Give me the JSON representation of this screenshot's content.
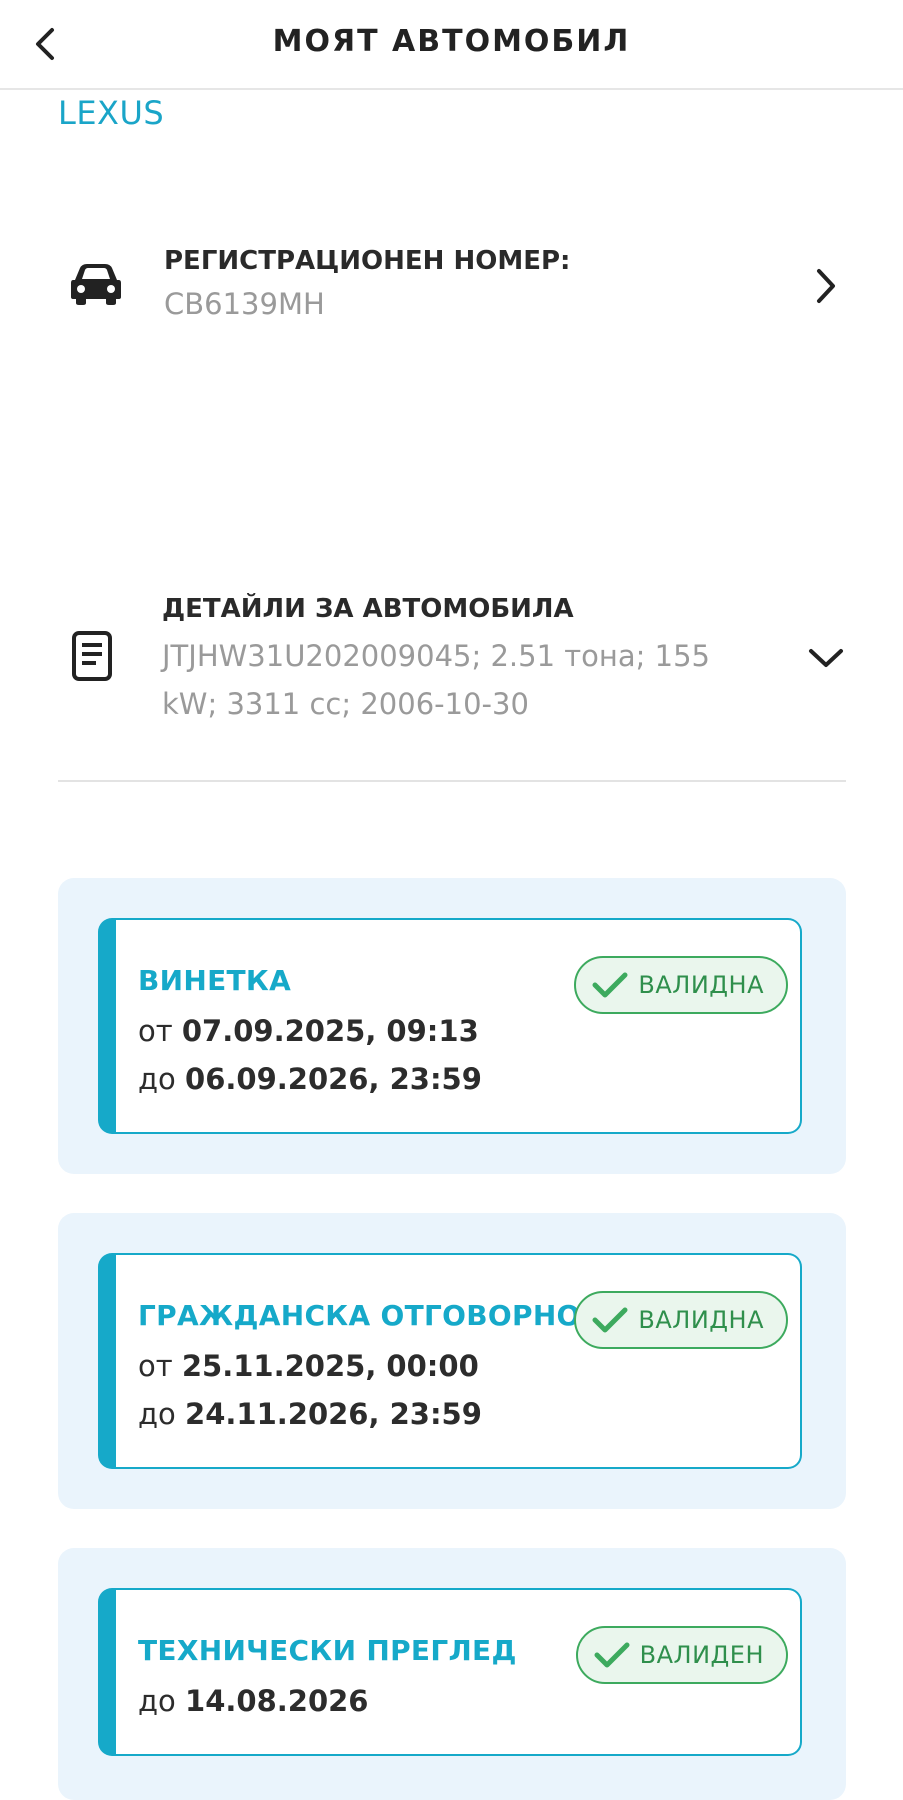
{
  "header": {
    "title": "МОЯТ АВТОМОБИЛ",
    "back_icon": "chevron-left-icon"
  },
  "brand": "LEXUS",
  "registration": {
    "label": "РЕГИСТРАЦИОНЕН НОМЕР:",
    "value": "CB6139MH",
    "icon": "car-icon",
    "action_icon": "chevron-right-icon"
  },
  "details": {
    "label": "ДЕТАЙЛИ ЗА АВТОМОБИЛА",
    "value_line1": "JTJHW31U202009045; 2.51 тона; 155",
    "value_line2": "kW; 3311 cc; 2006-10-30",
    "icon": "document-icon",
    "action_icon": "chevron-down-icon"
  },
  "cards": [
    {
      "title": "ВИНЕТКА",
      "from_prefix": "от",
      "from": "07.09.2025, 09:13",
      "to_prefix": "до",
      "to": "06.09.2026, 23:59",
      "status": "ВАЛИДНА"
    },
    {
      "title": "ГРАЖДАНСКА ОТГОВОРНОСТ",
      "from_prefix": "от",
      "from": "25.11.2025, 00:00",
      "to_prefix": "до",
      "to": "24.11.2026, 23:59",
      "status": "ВАЛИДНА"
    },
    {
      "title": "ТЕХНИЧЕСКИ ПРЕГЛЕД",
      "to_prefix": "до",
      "to": "14.08.2026",
      "status": "ВАЛИДЕН"
    }
  ],
  "colors": {
    "accent": "#16a9c9",
    "brand": "#1aa5c8",
    "panel_bg": "#eaf4fc",
    "valid_green": "#3daa5e",
    "muted_text": "#9a9a9a"
  }
}
